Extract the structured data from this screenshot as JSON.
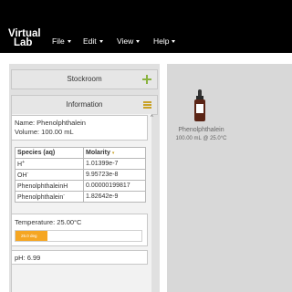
{
  "app": {
    "logo_line1": "Virtual",
    "logo_line2": "Lab"
  },
  "menu": [
    {
      "label": "File"
    },
    {
      "label": "Edit"
    },
    {
      "label": "View"
    },
    {
      "label": "Help"
    }
  ],
  "sidebar": {
    "stockroom_title": "Stockroom",
    "information_title": "Information",
    "name_line": "Name: Phenolphthalein",
    "volume_line": "Volume: 100.00 mL",
    "species_header": "Species (aq)",
    "molarity_header": "Molarity",
    "species": [
      {
        "name": "H",
        "sup": "+",
        "value": "1.01399e-7"
      },
      {
        "name": "OH",
        "sup": "-",
        "value": "9.95723e-8"
      },
      {
        "name": "PhenolphthaleinH",
        "sup": "",
        "value": "0.00000199817"
      },
      {
        "name": "Phenolphthalein",
        "sup": "-",
        "value": "1.82642e-9"
      }
    ],
    "temperature_label": "Temperature: 25.00°C",
    "slider_label": "25.0 deg",
    "slider_fraction": 0.25,
    "ph_label": "pH: 6.99"
  },
  "workbench": {
    "item_name": "Phenolphthalein",
    "item_info": "100.00 mL @ 25.0°C"
  },
  "colors": {
    "topbar": "#000000",
    "slider_fill": "#f5a623",
    "plus_icon": "#8ab33f",
    "menu_icon": "#c9a227",
    "bottle": "#5a2415"
  }
}
